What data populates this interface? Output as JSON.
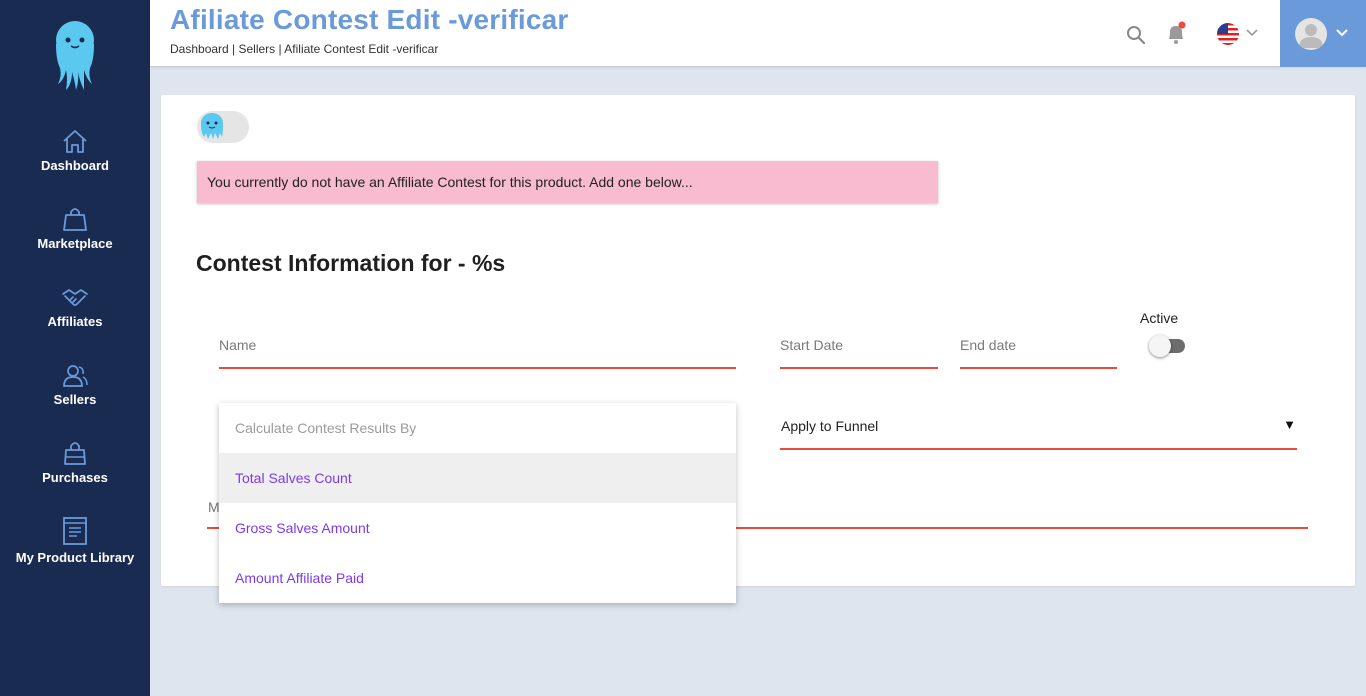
{
  "sidebar": {
    "logo_icon": "octopus-logo-icon",
    "items": [
      {
        "label": "Dashboard",
        "icon": "home-icon"
      },
      {
        "label": "Marketplace",
        "icon": "shopping-bag-icon"
      },
      {
        "label": "Affiliates",
        "icon": "handshake-icon"
      },
      {
        "label": "Sellers",
        "icon": "users-icon"
      },
      {
        "label": "Purchases",
        "icon": "bag-icon"
      },
      {
        "label": "My Product Library",
        "icon": "library-icon"
      }
    ]
  },
  "header": {
    "title": "Afiliate Contest Edit -verificar",
    "breadcrumb": "Dashboard | Sellers | Afiliate Contest Edit -verificar",
    "icons": [
      "search-icon",
      "bell-icon",
      "us-flag-icon",
      "chevron-down-icon",
      "avatar",
      "chevron-down-icon"
    ]
  },
  "alert": {
    "text": "You currently do not have an Affiliate Contest for this product. Add one below..."
  },
  "form": {
    "title": "Contest Information for - %s",
    "name_placeholder": "Name",
    "start_date_placeholder": "Start Date",
    "end_date_placeholder": "End date",
    "active_label": "Active",
    "active": false,
    "funnel_label": "Apply to Funnel",
    "funnel_caret": "▼",
    "message_placeholder_letter": "M"
  },
  "dropdown": {
    "placeholder": "Calculate Contest Results By",
    "options": [
      "Total Salves Count",
      "Gross Salves Amount",
      "Amount Affiliate Paid"
    ],
    "hovered_index": 0
  },
  "colors": {
    "sidebar_bg": "#1a2b52",
    "accent_blue": "#6a9ad9",
    "field_underline": "#e74c3c",
    "alert_bg": "#f8bbcf",
    "option_text": "#7c3aed"
  }
}
